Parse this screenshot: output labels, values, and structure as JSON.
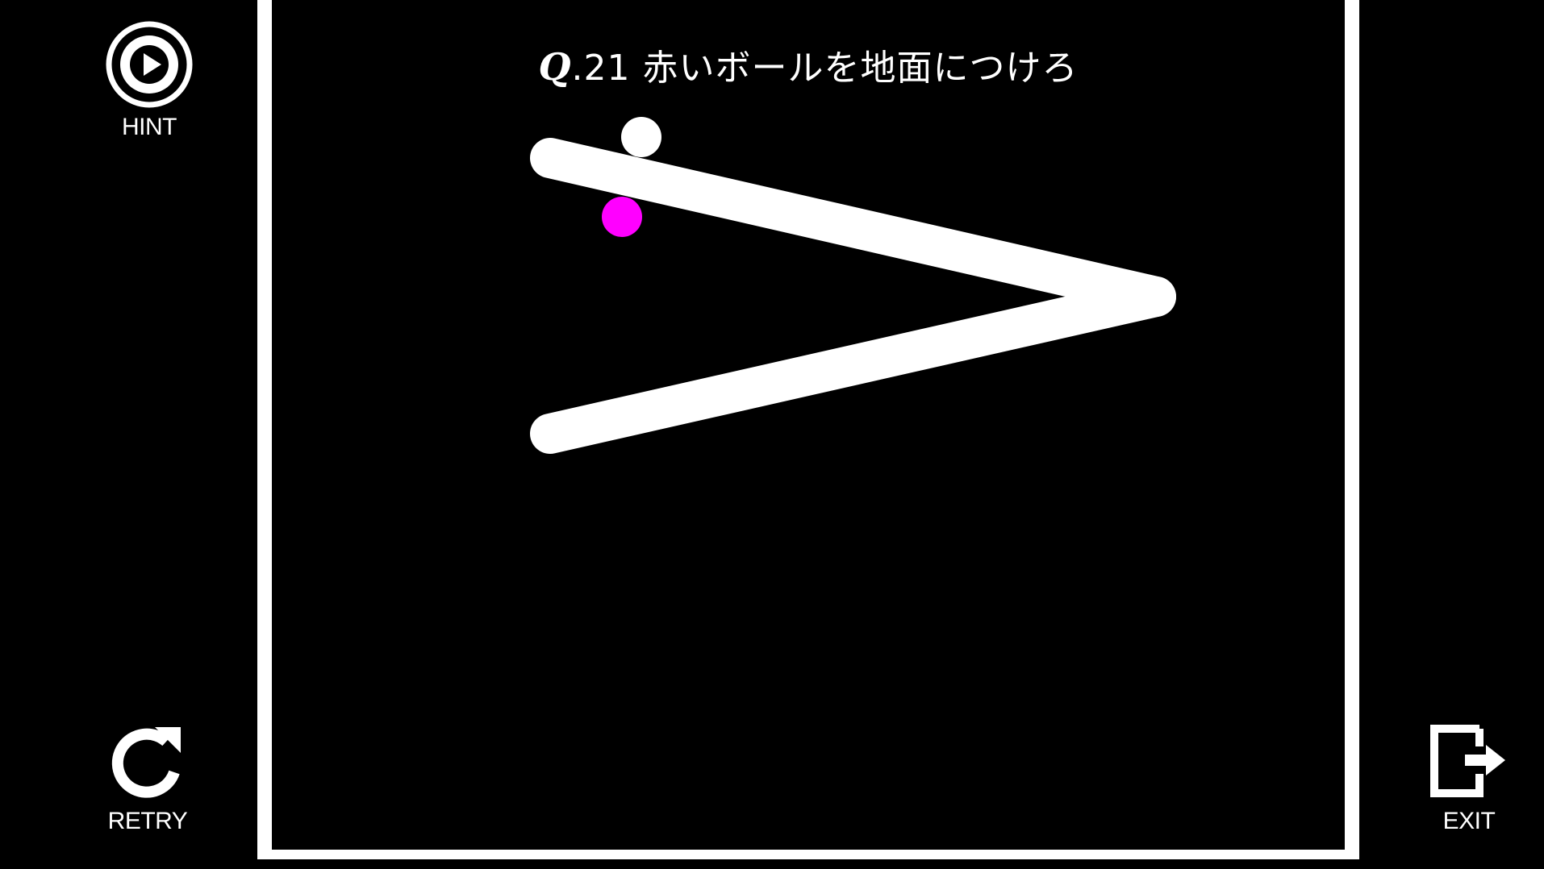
{
  "hud": {
    "hint_label": "HINT",
    "retry_label": "RETRY",
    "exit_label": "EXIT"
  },
  "question": {
    "prefix": "Q",
    "number": ".21",
    "text": "赤いボールを地面につけろ"
  },
  "colors": {
    "background": "#000000",
    "foreground": "#ffffff",
    "red_ball": "#ff00ff",
    "white_ball": "#ffffff"
  },
  "icons": {
    "hint": "play-circle-icon",
    "retry": "retry-arrow-icon",
    "exit": "exit-door-icon"
  }
}
